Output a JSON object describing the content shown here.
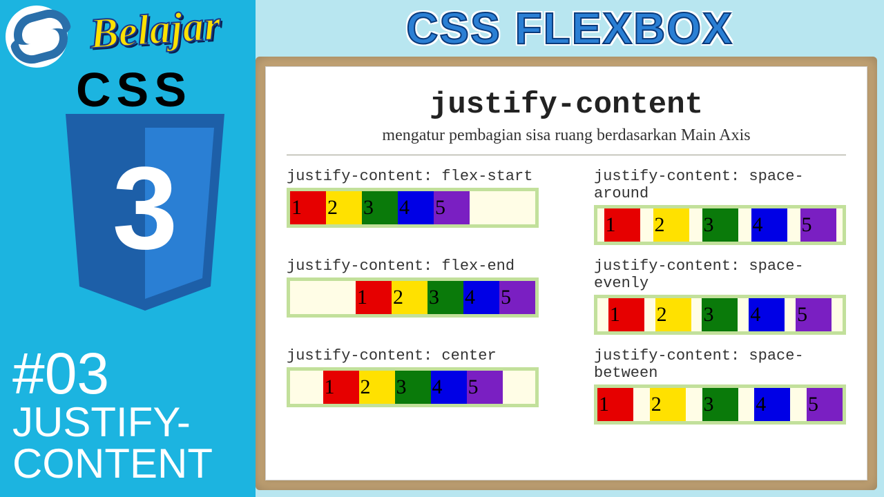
{
  "sidebar": {
    "belajar": "Belajar",
    "css_label": "CSS",
    "shield_number": "3",
    "episode_num": "#03",
    "episode_title_1": "JUSTIFY-",
    "episode_title_2": "CONTENT"
  },
  "header": {
    "title": "CSS FLEXBOX"
  },
  "content": {
    "heading": "justify-content",
    "subtitle": "mengatur pembagian sisa ruang berdasarkan Main Axis",
    "boxes": [
      "1",
      "2",
      "3",
      "4",
      "5"
    ],
    "examples": [
      {
        "label": "justify-content: flex-start",
        "mode": "flex-start"
      },
      {
        "label": "justify-content: space-around",
        "mode": "space-around"
      },
      {
        "label": "justify-content: flex-end",
        "mode": "flex-end"
      },
      {
        "label": "justify-content: space-evenly",
        "mode": "space-evenly"
      },
      {
        "label": "justify-content: center",
        "mode": "center"
      },
      {
        "label": "justify-content: space-between",
        "mode": "space-between"
      }
    ]
  }
}
